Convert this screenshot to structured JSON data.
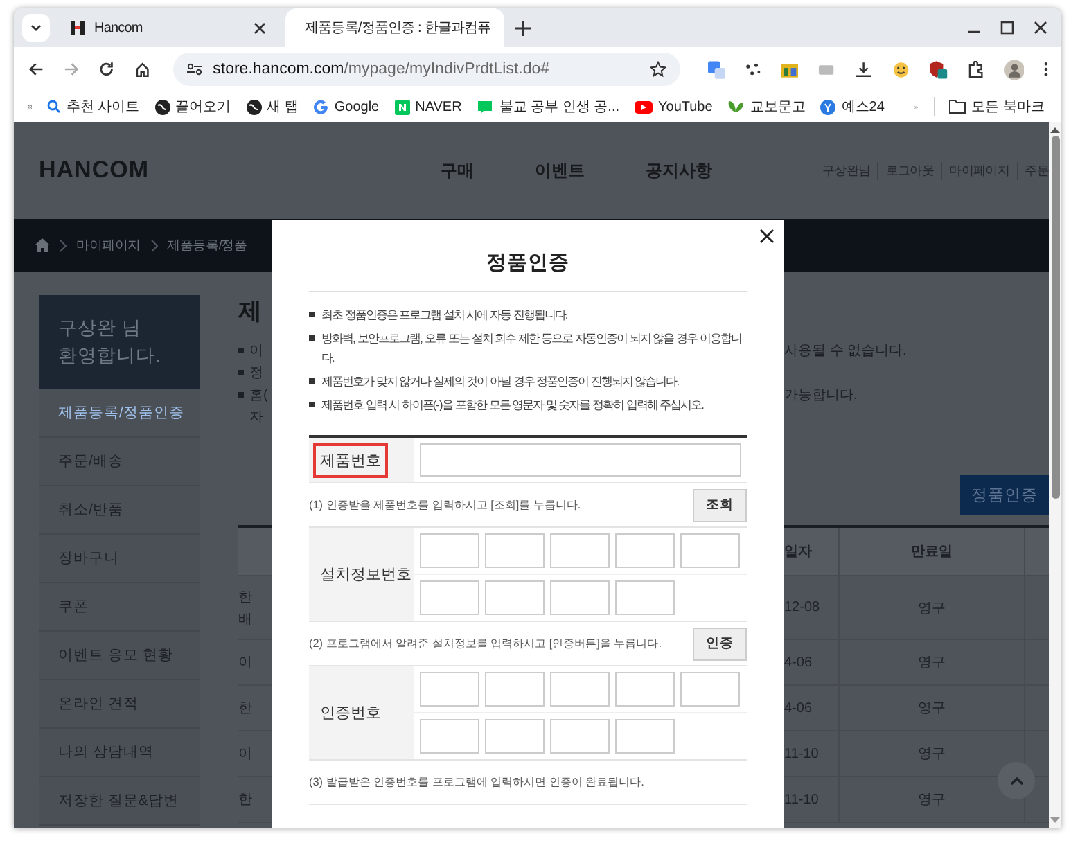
{
  "browser": {
    "tabs": [
      {
        "title": "Hancom",
        "selected": false
      },
      {
        "title": "제품등록/정품인증 : 한글과컴퓨",
        "selected": true
      }
    ],
    "url": {
      "domain": "store.hancom.com",
      "path": "/mypage/myIndivPrdtList.do#"
    },
    "bookmarks": [
      {
        "label": "추천 사이트",
        "kind": "search"
      },
      {
        "label": "끌어오기",
        "kind": "globe"
      },
      {
        "label": "새 탭",
        "kind": "globe"
      },
      {
        "label": "Google",
        "kind": "google"
      },
      {
        "label": "NAVER",
        "kind": "naver"
      },
      {
        "label": "불교 공부 인생 공...",
        "kind": "blog"
      },
      {
        "label": "YouTube",
        "kind": "youtube"
      },
      {
        "label": "교보문고",
        "kind": "leaf"
      },
      {
        "label": "예스24",
        "kind": "yes"
      }
    ],
    "all_bookmarks": "모든 북마크"
  },
  "site": {
    "logo": "HANCOM",
    "nav": [
      "구매",
      "이벤트",
      "공지사항"
    ],
    "user_links": [
      "구상완님",
      "로그아웃",
      "마이페이지",
      "주문"
    ],
    "breadcrumb": [
      "마이페이지",
      "제품등록/정품"
    ],
    "sidebar": {
      "welcome": [
        "구상완 님",
        "환영합니다."
      ],
      "items": [
        {
          "label": "제품등록/정품인증",
          "selected": true
        },
        {
          "label": "주문/배송",
          "selected": false
        },
        {
          "label": "취소/반품",
          "selected": false
        },
        {
          "label": "장바구니",
          "selected": false
        },
        {
          "label": "쿠폰",
          "selected": false
        },
        {
          "label": "이벤트 응모 현황",
          "selected": false
        },
        {
          "label": "온라인 견적",
          "selected": false
        },
        {
          "label": "나의 상담내역",
          "selected": false
        },
        {
          "label": "저장한 질문&답변",
          "selected": false
        }
      ]
    },
    "page_title": "제",
    "notes": [
      {
        "bullet": true,
        "left": "이",
        "right": "사용될 수 없습니다."
      },
      {
        "bullet": true,
        "left": "정"
      },
      {
        "bullet": true,
        "left": "홈(",
        "right": "가능합니다."
      },
      {
        "bullet": false,
        "left": "자"
      }
    ],
    "action_button": "정품인증",
    "table": {
      "columns": [
        "일자",
        "만료일"
      ],
      "rows": [
        {
          "product": [
            "한",
            "배"
          ],
          "date": "12-08",
          "expiry": "영구"
        },
        {
          "product": [
            "이"
          ],
          "date": "4-06",
          "expiry": "영구"
        },
        {
          "product": [
            "한"
          ],
          "date": "4-06",
          "expiry": "영구"
        },
        {
          "product": [
            "이"
          ],
          "date": "11-10",
          "expiry": "영구"
        },
        {
          "product": [
            "한"
          ],
          "date": "11-10",
          "expiry": "영구"
        }
      ]
    }
  },
  "modal": {
    "title": "정품인증",
    "notes": [
      "최초 정품인증은 프로그램 설치 시에 자동 진행됩니다.",
      "방화벽, 보안프로그램, 오류 또는 설치 회수 제한 등으로 자동인증이 되지 않을 경우 이용합니다.",
      "제품번호가 맞지 않거나 실제의 것이 아닐 경우 정품인증이 진행되지 않습니다.",
      "제품번호 입력 시 하이픈(-)을 포함한 모든 영문자 및 숫자를 정확히 입력해 주십시오."
    ],
    "rows": [
      {
        "kind": "field",
        "label": "제품번호",
        "highlighted": true
      },
      {
        "kind": "step",
        "text": "(1) 인증받을 제품번호를 입력하시고 [조회]를 누릅니다.",
        "button": "조회"
      },
      {
        "kind": "boxes",
        "label": "설치정보번호",
        "highlighted": false
      },
      {
        "kind": "step",
        "text": "(2) 프로그램에서 알려준 설치정보를 입력하시고 [인증버튼]을 누릅니다.",
        "button": "인증"
      },
      {
        "kind": "boxes",
        "label": "인증번호",
        "highlighted": false
      },
      {
        "kind": "step",
        "text": "(3) 발급받은 인증번호를 프로그램에 입력하시면 인증이 완료됩니다."
      }
    ]
  }
}
